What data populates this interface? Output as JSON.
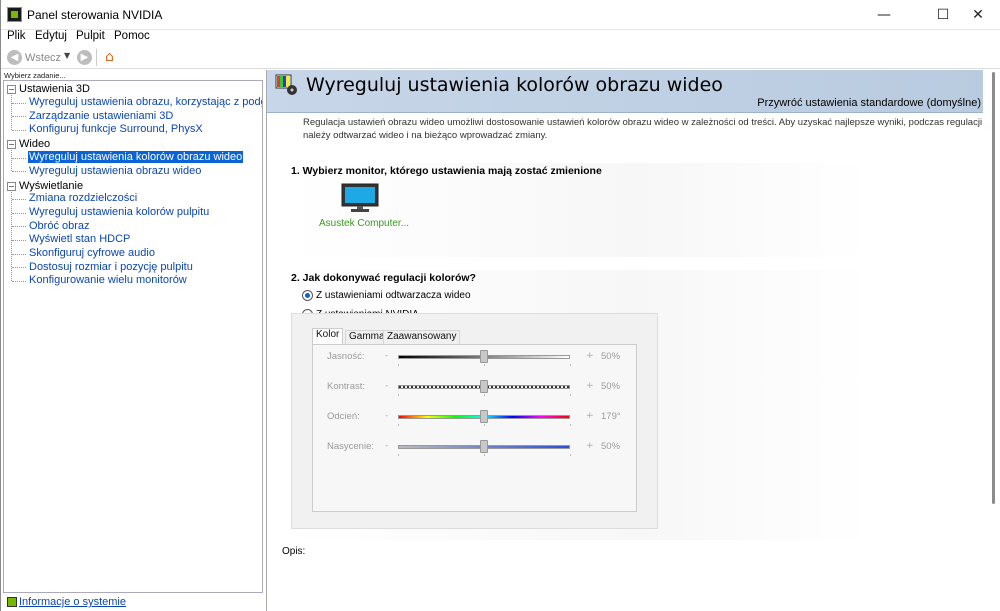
{
  "window": {
    "title": "Panel sterowania NVIDIA",
    "min": "—",
    "max": "☐",
    "close": "✕"
  },
  "menu": [
    "Plik",
    "Edytuj",
    "Pulpit",
    "Pomoc"
  ],
  "toolbar": {
    "back_label": "Wstecz"
  },
  "task_label": "Wybierz zadanie...",
  "tree": [
    {
      "label": "Ustawienia 3D",
      "items": [
        "Wyreguluj ustawienia obrazu, korzystając z podglądu",
        "Zarządzanie ustawieniami 3D",
        "Konfiguruj funkcje Surround, PhysX"
      ]
    },
    {
      "label": "Wideo",
      "items": [
        "Wyreguluj ustawienia kolorów obrazu wideo",
        "Wyreguluj ustawienia obrazu wideo"
      ]
    },
    {
      "label": "Wyświetlanie",
      "items": [
        "Zmiana rozdzielczości",
        "Wyreguluj ustawienia kolorów pulpitu",
        "Obróć obraz",
        "Wyświetl stan HDCP",
        "Skonfiguruj cyfrowe audio",
        "Dostosuj rozmiar i pozycję pulpitu",
        "Konfigurowanie wielu monitorów"
      ]
    }
  ],
  "info_link": "Informacje o systemie",
  "page": {
    "title": "Wyreguluj ustawienia kolorów obrazu wideo",
    "restore": "Przywróć ustawienia standardowe (domyślne)",
    "description": "Regulacja ustawień obrazu wideo umożliwi dostosowanie ustawień kolorów obrazu wideo w zależności od treści. Aby uzyskać najlepsze wyniki, podczas regulacji należy odtwarzać wideo i na bieżąco wprowadzać zmiany.",
    "sec1_title": "1. Wybierz monitor, którego ustawienia mają zostać zmienione",
    "monitor_label": "Asustek Computer...",
    "sec2_title": "2. Jak dokonywać regulacji kolorów?",
    "radio1": "Z ustawieniami odtwarzacza wideo",
    "radio2": "Z ustawieniami NVIDIA",
    "tabs": [
      "Kolor",
      "Gamma",
      "Zaawansowany"
    ],
    "sliders": [
      {
        "label": "Jasność:",
        "minus": "-",
        "plus": "+",
        "value": "50%",
        "level": 0.5
      },
      {
        "label": "Kontrast:",
        "minus": "-",
        "plus": "+",
        "value": "50%",
        "level": 0.5
      },
      {
        "label": "Odcień:",
        "minus": "-",
        "plus": "+",
        "value": "179°",
        "level": 0.5
      },
      {
        "label": "Nasycenie:",
        "minus": "-",
        "plus": "+",
        "value": "50%",
        "level": 0.5
      }
    ],
    "opis": "Opis:"
  },
  "colors": {
    "accent": "#0a64d8",
    "link": "#0b46b5",
    "nvidia_green": "#76b900",
    "banner": "#c7d6e8"
  }
}
